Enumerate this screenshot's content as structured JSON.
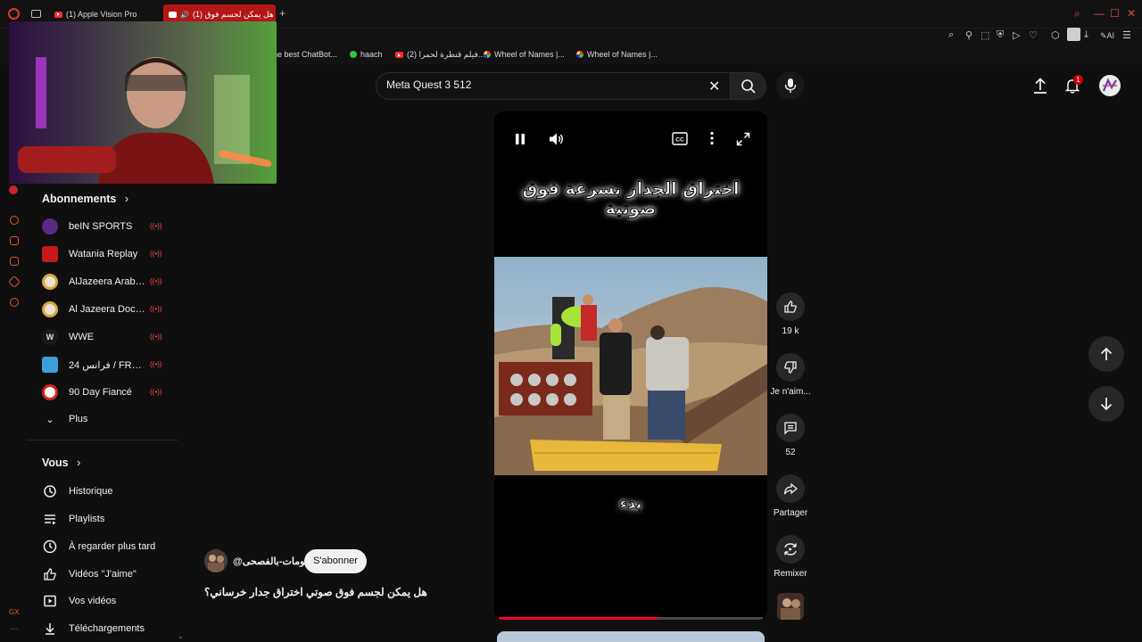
{
  "browser": {
    "tabs": [
      {
        "label": "(1) Apple Vision Pro"
      },
      {
        "label": "(1) هل يمكن لجسم فوق"
      }
    ],
    "bookmarks": [
      {
        "label": "he best ChatBot..."
      },
      {
        "label": "haach"
      },
      {
        "label": "(2) فيلم قنطرة لحمرا..."
      },
      {
        "label": "Wheel of Names |..."
      },
      {
        "label": "Wheel of Names |..."
      }
    ],
    "ai_label": "AI"
  },
  "search": {
    "value": "Meta Quest 3 512"
  },
  "header": {
    "notif_count": "1"
  },
  "sidebar": {
    "subscriptions_title": "Abonnements",
    "subscriptions": [
      {
        "label": "beIN SPORTS",
        "color": "#5b2a86"
      },
      {
        "label": "Watania Replay",
        "color": "#c31b1b"
      },
      {
        "label": "AlJazeera Arabic...",
        "color": "#d8a93a"
      },
      {
        "label": "Al Jazeera Docu...",
        "color": "#d8a93a"
      },
      {
        "label": "WWE",
        "color": "#1a1a1a"
      },
      {
        "label": "فرانس 24 / FRANC...",
        "color": "#3aa0d8"
      },
      {
        "label": "90 Day Fiancé",
        "color": "#d42222"
      }
    ],
    "more_label": "Plus",
    "you_title": "Vous",
    "you_items": [
      {
        "label": "Historique",
        "icon": "history-icon"
      },
      {
        "label": "Playlists",
        "icon": "playlist-icon"
      },
      {
        "label": "À regarder plus tard",
        "icon": "clock-icon"
      },
      {
        "label": "Vidéos \"J'aime\"",
        "icon": "thumb-up-icon"
      },
      {
        "label": "Vos vidéos",
        "icon": "video-icon"
      },
      {
        "label": "Téléchargements",
        "icon": "download-icon"
      }
    ]
  },
  "short": {
    "caption_top": "اختراق الجدار بسرعة فوق صوتية",
    "caption_bottom": "بدء",
    "channel": "@معلومات-بالفصحى",
    "subscribe_label": "S'abonner",
    "title": "هل يمكن لجسم فوق صوتي اختراق جدار خرساني؟",
    "progress": 0.6
  },
  "actions": {
    "likes": "19 k",
    "dislike_label": "Je n'aim...",
    "comments": "52",
    "share_label": "Partager",
    "remix_label": "Remixer"
  }
}
